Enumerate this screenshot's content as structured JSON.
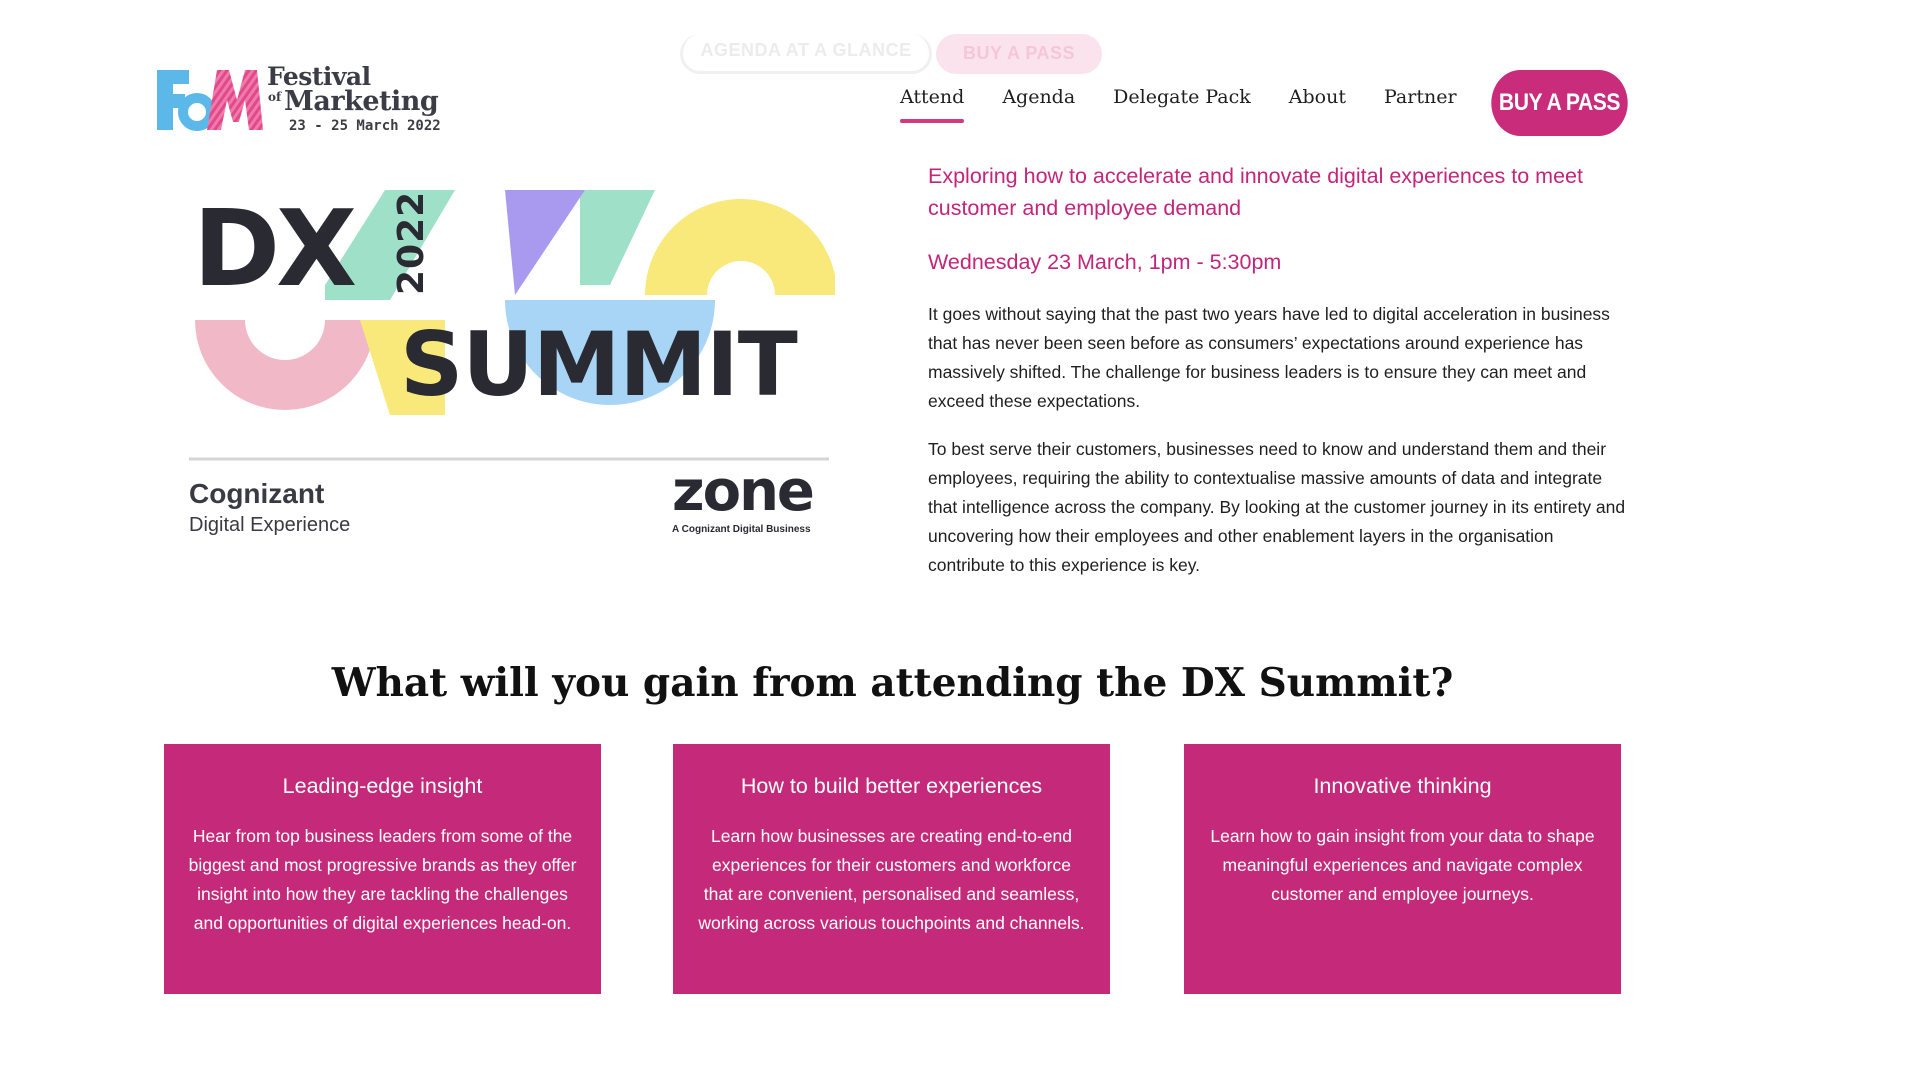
{
  "ghost_buttons": {
    "agenda": "Agenda at a glance",
    "buy": "Buy a pass"
  },
  "logo": {
    "line1": "Festival",
    "of": "of",
    "line2": "Marketing",
    "dates": "23 - 25 March 2022",
    "colors": {
      "blue": "#5bb8e8",
      "pink": "#e04a8c",
      "dark": "#3c3c46"
    }
  },
  "nav": {
    "items": [
      {
        "label": "Attend",
        "active": true
      },
      {
        "label": "Agenda"
      },
      {
        "label": "Delegate Pack"
      },
      {
        "label": "About"
      },
      {
        "label": "Partner"
      }
    ],
    "buy_label": "BUY A PASS"
  },
  "summit_graphic": {
    "dx": "DX",
    "year": "2022",
    "summit": "SUMMIT",
    "sponsor1_line1": "Cognizant",
    "sponsor1_line2": "Digital Experience",
    "sponsor2": "zone",
    "sponsor2_sub": "A Cognizant Digital Business",
    "colors": {
      "mint": "#9fe0c9",
      "purple": "#a99af0",
      "yellow": "#f8e97a",
      "pink": "#f1b8c8",
      "blue": "#a8d4f5",
      "dark": "#2a2a33"
    }
  },
  "intro": {
    "headline": "Exploring how to accelerate and innovate digital experiences to meet customer and employee demand",
    "when": "Wednesday 23 March, 1pm - 5:30pm",
    "para1": "It goes without saying that the past two years have led to digital acceleration in business that has never been seen before as consumers’ expectations around experience has massively shifted. The challenge for business leaders is to ensure they can meet and exceed these expectations.",
    "para2": "To best serve their customers, businesses need to know and understand them and their employees, requiring the ability to contextualise massive amounts of data and integrate that intelligence across the company. By looking at the customer journey in its entirety and uncovering how their employees and other enablement layers in the organisation contribute to this experience is key."
  },
  "gain_title": "What will you gain from attending the DX Summit?",
  "cards": [
    {
      "title": "Leading-edge insight",
      "body": "Hear from top business leaders from some of the biggest and most progressive brands as they offer insight into how they are tackling the challenges and opportunities of digital experiences head-on."
    },
    {
      "title": "How to build better experiences",
      "body": "Learn how businesses are creating end-to-end experiences for their customers and workforce that are convenient, personalised and seamless, working across various touchpoints and channels."
    },
    {
      "title": "Innovative thinking",
      "body": "Learn how to gain insight from your data to shape meaningful experiences and navigate complex customer and employee journeys."
    }
  ],
  "accent_color": "#c92c7a"
}
